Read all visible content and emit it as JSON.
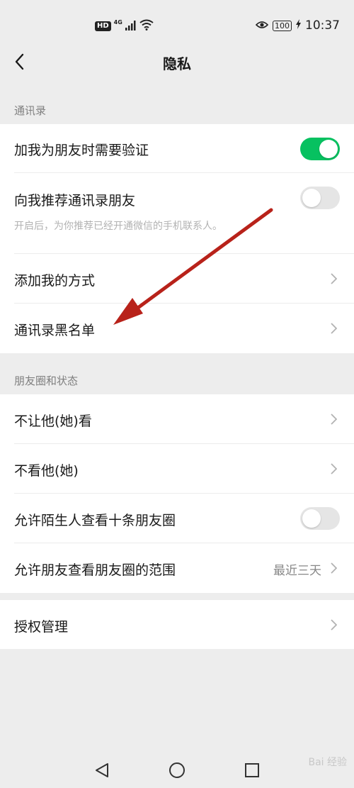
{
  "status_bar": {
    "hd_label": "HD",
    "network_label": "4G",
    "battery_label": "100",
    "time": "10:37",
    "icons": [
      "signal-icon",
      "wifi-icon",
      "eye-icon",
      "battery-icon",
      "charging-icon"
    ]
  },
  "nav": {
    "title": "隐私",
    "back_icon": "chevron-left-icon"
  },
  "sections": {
    "contacts": {
      "header": "通讯录",
      "add_verify": {
        "label": "加我为朋友时需要验证",
        "toggle_on": true
      },
      "recommend": {
        "label": "向我推荐通讯录朋友",
        "sub": "开启后，为你推荐已经开通微信的手机联系人。",
        "toggle_on": false
      },
      "add_methods": {
        "label": "添加我的方式"
      },
      "blacklist": {
        "label": "通讯录黑名单"
      }
    },
    "moments": {
      "header": "朋友圈和状态",
      "hide_from": {
        "label": "不让他(她)看"
      },
      "dont_see": {
        "label": "不看他(她)"
      },
      "stranger_ten": {
        "label": "允许陌生人查看十条朋友圈",
        "toggle_on": false
      },
      "visible_range": {
        "label": "允许朋友查看朋友圈的范围",
        "value": "最近三天"
      }
    },
    "auth": {
      "manage": {
        "label": "授权管理"
      }
    }
  },
  "bottom_nav": {
    "icons": [
      "back-triangle-icon",
      "home-circle-icon",
      "recents-square-icon"
    ]
  },
  "watermark": "Bai 经验",
  "colors": {
    "background": "#ededed",
    "toggle_on": "#07c160",
    "toggle_off": "#e5e5e5",
    "annotation_arrow": "#b8221a"
  }
}
